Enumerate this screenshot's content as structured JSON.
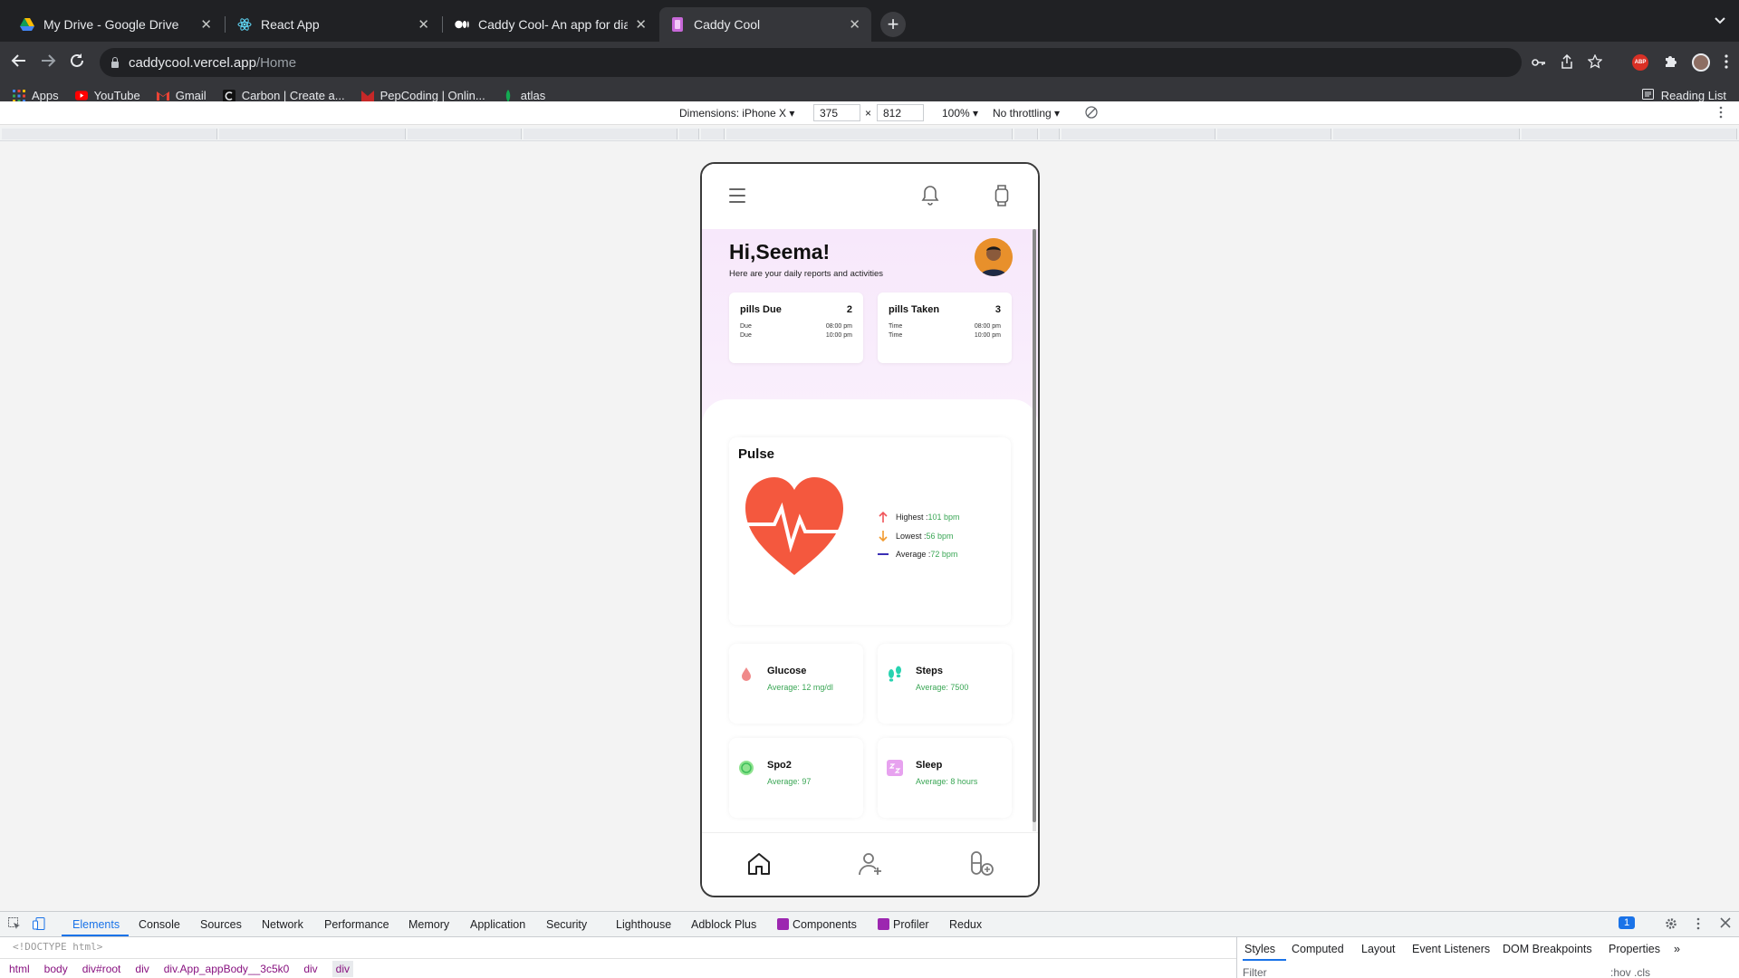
{
  "browser": {
    "tabs": [
      {
        "title": "My Drive - Google Drive",
        "favicon": "google-drive-icon",
        "active": false
      },
      {
        "title": "React App",
        "favicon": "react-icon",
        "active": false
      },
      {
        "title": "Caddy Cool- An app for diabet",
        "favicon": "medium-icon",
        "active": false
      },
      {
        "title": "Caddy Cool",
        "favicon": "caddy-icon",
        "active": true
      }
    ],
    "close_glyph": "✕",
    "new_tab_glyph": "+",
    "url_host": "caddycool.vercel.app",
    "url_path": "/Home",
    "bookmarks": [
      {
        "label": "Apps",
        "icon": "apps-grid-icon"
      },
      {
        "label": "YouTube",
        "icon": "youtube-icon"
      },
      {
        "label": "Gmail",
        "icon": "gmail-icon"
      },
      {
        "label": "Carbon | Create a...",
        "icon": "carbon-icon"
      },
      {
        "label": "PepCoding | Onlin...",
        "icon": "pepcoding-icon"
      },
      {
        "label": "atlas",
        "icon": "atlas-icon"
      }
    ],
    "reading_list": "Reading List",
    "abp_label": "ABP"
  },
  "device_toolbar": {
    "dimensions_label": "Dimensions: iPhone X ▾",
    "width": "375",
    "times": "×",
    "height": "812",
    "zoom": "100% ▾",
    "throttling": "No throttling ▾"
  },
  "app": {
    "greeting": "Hi,Seema!",
    "subtitle": "Here are your daily reports and activities",
    "pills_due": {
      "title": "pills Due",
      "count": "2",
      "rows": [
        {
          "label": "Due",
          "time": "08:00 pm"
        },
        {
          "label": "Due",
          "time": "10:00 pm"
        }
      ]
    },
    "pills_taken": {
      "title": "pills Taken",
      "count": "3",
      "rows": [
        {
          "label": "Time",
          "time": "08:00 pm"
        },
        {
          "label": "Time",
          "time": "10:00 pm"
        }
      ]
    },
    "pulse": {
      "title": "Pulse",
      "stats": [
        {
          "label": "Highest :",
          "value": "101 bpm",
          "icon": "arrow-up-icon"
        },
        {
          "label": "Lowest :",
          "value": "56 bpm",
          "icon": "arrow-down-icon"
        },
        {
          "label": "Average :",
          "value": "72 bpm",
          "icon": "average-line-icon"
        }
      ]
    },
    "metrics": [
      {
        "title": "Glucose",
        "value": "Average: 12 mg/dl",
        "icon": "blood-drop-icon"
      },
      {
        "title": "Steps",
        "value": "Average: 7500",
        "icon": "footsteps-icon"
      },
      {
        "title": "Spo2",
        "value": "Average: 97",
        "icon": "oxygen-icon"
      },
      {
        "title": "Sleep",
        "value": "Average: 8 hours",
        "icon": "sleep-icon"
      }
    ],
    "colors": {
      "hero_bg": "#f7e8fb",
      "heart": "#f4583e",
      "value_green": "#3aa655"
    }
  },
  "devtools": {
    "tabs": [
      "Elements",
      "Console",
      "Sources",
      "Network",
      "Performance",
      "Memory",
      "Application",
      "Security",
      "Lighthouse",
      "Adblock Plus",
      "Components",
      "Profiler",
      "Redux"
    ],
    "badge": "1",
    "doctype": "<!DOCTYPE html>",
    "breadcrumbs": [
      "html",
      "body",
      "div#root",
      "div",
      "div.App_appBody__3c5k0",
      "div",
      "div"
    ],
    "styles_tabs": [
      "Styles",
      "Computed",
      "Layout",
      "Event Listeners",
      "DOM Breakpoints",
      "Properties"
    ],
    "more_glyph": "»",
    "filter_placeholder": "Filter",
    "hov_cls": ":hov  .cls"
  }
}
